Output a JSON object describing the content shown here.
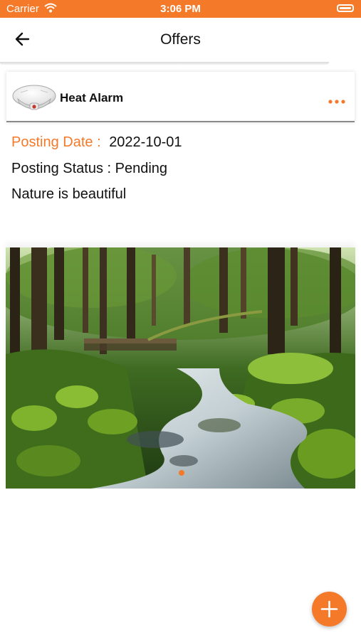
{
  "status_bar": {
    "carrier": "Carrier",
    "time": "3:06 PM",
    "wifi_icon": "wifi-icon",
    "battery_icon": "battery-icon"
  },
  "nav": {
    "title": "Offers",
    "back_icon": "back-arrow-icon"
  },
  "offer": {
    "product_name": "Heat Alarm",
    "product_icon": "heat-alarm-thumbnail",
    "menu_icon": "more-horizontal-icon",
    "posting_date_label": "Posting Date :",
    "posting_date_value": "2022-10-01",
    "posting_status_label": "Posting Status :",
    "posting_status_value": "Pending",
    "description": "Nature is beautiful",
    "image": "forest-stream-photo",
    "image_pages": 1,
    "current_page": 1
  },
  "fab": {
    "icon": "plus-icon"
  },
  "colors": {
    "accent": "#f47a2a",
    "text": "#111111",
    "background": "#ffffff"
  }
}
